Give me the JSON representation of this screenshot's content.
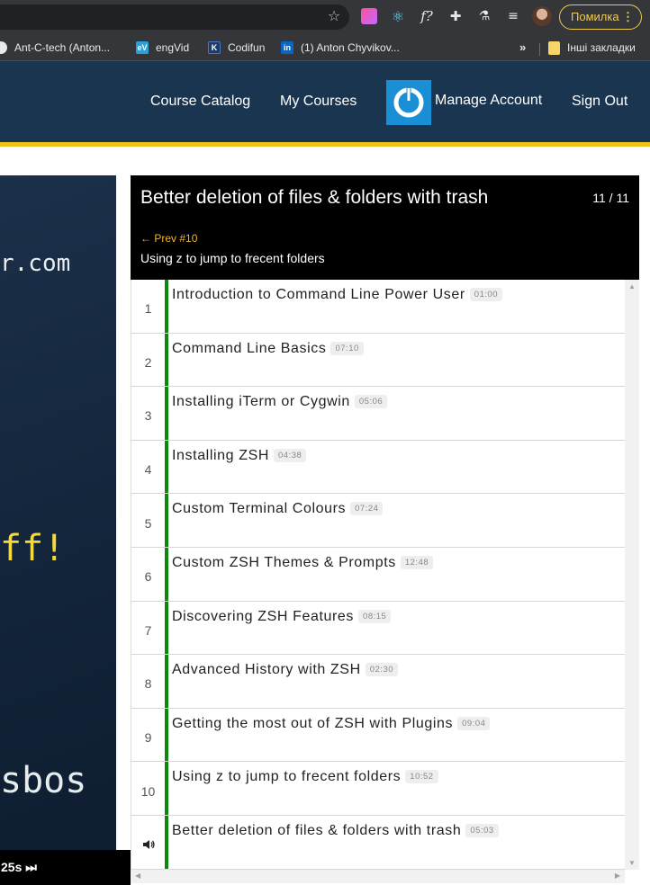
{
  "browser": {
    "error_label": "Помилка",
    "bookmarks": [
      "Ant-C-tech (Anton...",
      "engVid",
      "Codifun",
      "(1) Anton Chyvikov...",
      "Інші закладки"
    ],
    "more_label": "»"
  },
  "site": {
    "nav": {
      "catalog": "Course Catalog",
      "my_courses": "My Courses",
      "manage": "Manage Account",
      "signout": "Sign Out"
    }
  },
  "video": {
    "lines": [
      "r.com",
      "ff!",
      "sbos"
    ],
    "time": "25s"
  },
  "playlist": {
    "title": "Better deletion of files & folders with trash",
    "counter": "11 / 11",
    "prev_label": "← Prev #10",
    "prev_title": "Using z to jump to frecent folders",
    "items": [
      {
        "num": "1",
        "title": "Introduction to Command Line Power User",
        "duration": "01:00"
      },
      {
        "num": "2",
        "title": "Command Line Basics",
        "duration": "07:10"
      },
      {
        "num": "3",
        "title": "Installing iTerm or Cygwin",
        "duration": "05:06"
      },
      {
        "num": "4",
        "title": "Installing ZSH",
        "duration": "04:38"
      },
      {
        "num": "5",
        "title": "Custom Terminal Colours",
        "duration": "07:24"
      },
      {
        "num": "6",
        "title": "Custom ZSH Themes & Prompts",
        "duration": "12:48"
      },
      {
        "num": "7",
        "title": "Discovering ZSH Features",
        "duration": "08:15"
      },
      {
        "num": "8",
        "title": "Advanced History with ZSH",
        "duration": "02:30"
      },
      {
        "num": "9",
        "title": "Getting the most out of ZSH with Plugins",
        "duration": "09:04"
      },
      {
        "num": "10",
        "title": "Using z to jump to frecent folders",
        "duration": "10:52"
      },
      {
        "num": "speaker-icon",
        "title": "Better deletion of files & folders with trash",
        "duration": "05:03"
      }
    ]
  },
  "colors": {
    "header_bg": "#1a3550",
    "accent_gold": "#f3c21a",
    "watched_bar": "#0a8a0a",
    "prev_link": "#f3b61f"
  }
}
